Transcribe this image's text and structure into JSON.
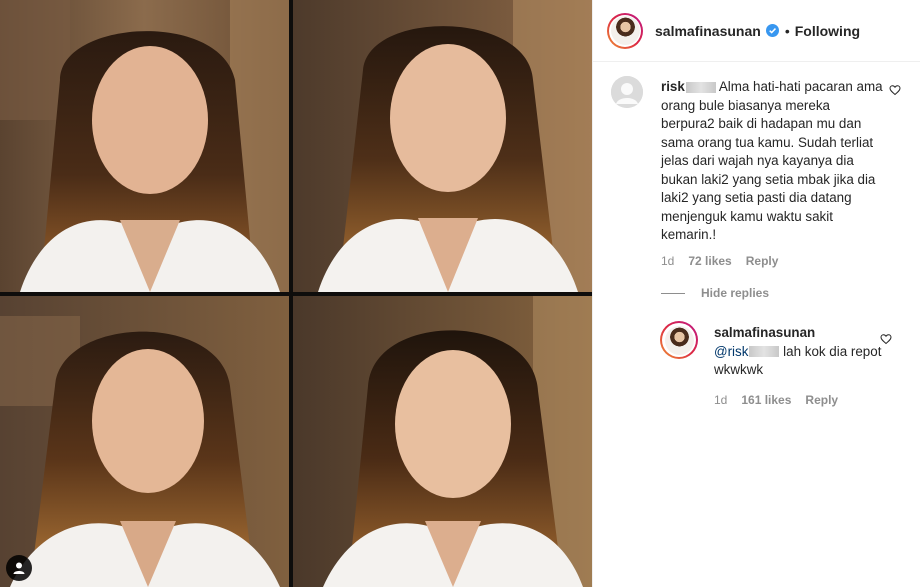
{
  "header": {
    "username": "salmafinasunan",
    "separator": "•",
    "follow_status": "Following"
  },
  "comments": [
    {
      "username": "risk",
      "text": "Alma hati-hati pacaran ama orang bule biasanya mereka berpura2 baik di hadapan mu dan sama orang tua kamu. Sudah terliat jelas dari wajah nya kayanya dia bukan laki2 yang setia mbak jika dia laki2 yang setia pasti dia datang menjenguk kamu waktu sakit kemarin.!",
      "time": "1d",
      "likes": "72 likes",
      "reply_label": "Reply"
    }
  ],
  "hide_replies_label": "Hide replies",
  "reply": {
    "username": "salmafinasunan",
    "mention": "@risk",
    "text": "lah kok dia repot wkwkwk",
    "time": "1d",
    "likes": "161 likes",
    "reply_label": "Reply"
  },
  "colors": {
    "accent_blue": "#3897f0",
    "muted_text": "#8e8e8e",
    "mention": "#00376b"
  },
  "icons": [
    "verified-badge-icon",
    "heart-outline-icon",
    "user-tag-icon",
    "default-avatar-icon"
  ]
}
